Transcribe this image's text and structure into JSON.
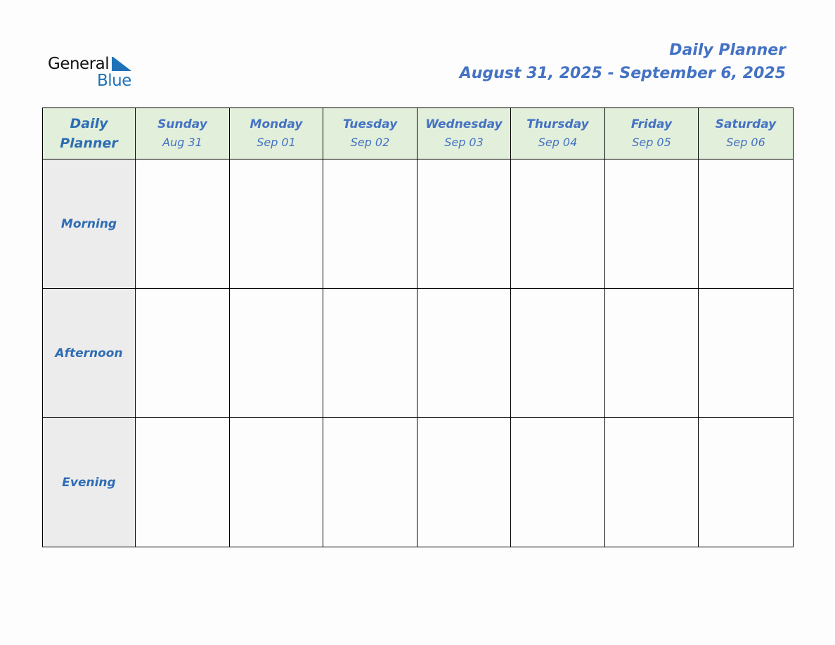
{
  "logo": {
    "line1": "General",
    "line2": "Blue"
  },
  "header": {
    "title": "Daily Planner",
    "date_range": "August 31, 2025 - September 6, 2025"
  },
  "table": {
    "corner_line1": "Daily",
    "corner_line2": "Planner",
    "days": [
      {
        "name": "Sunday",
        "date": "Aug 31"
      },
      {
        "name": "Monday",
        "date": "Sep 01"
      },
      {
        "name": "Tuesday",
        "date": "Sep 02"
      },
      {
        "name": "Wednesday",
        "date": "Sep 03"
      },
      {
        "name": "Thursday",
        "date": "Sep 04"
      },
      {
        "name": "Friday",
        "date": "Sep 05"
      },
      {
        "name": "Saturday",
        "date": "Sep 06"
      }
    ],
    "rows": [
      {
        "label": "Morning"
      },
      {
        "label": "Afternoon"
      },
      {
        "label": "Evening"
      }
    ]
  },
  "colors": {
    "accent": "#4472c4",
    "label": "#2e6db4",
    "header_bg": "#e2efda",
    "label_bg": "#ececec",
    "logo_blue": "#1f72b8"
  }
}
